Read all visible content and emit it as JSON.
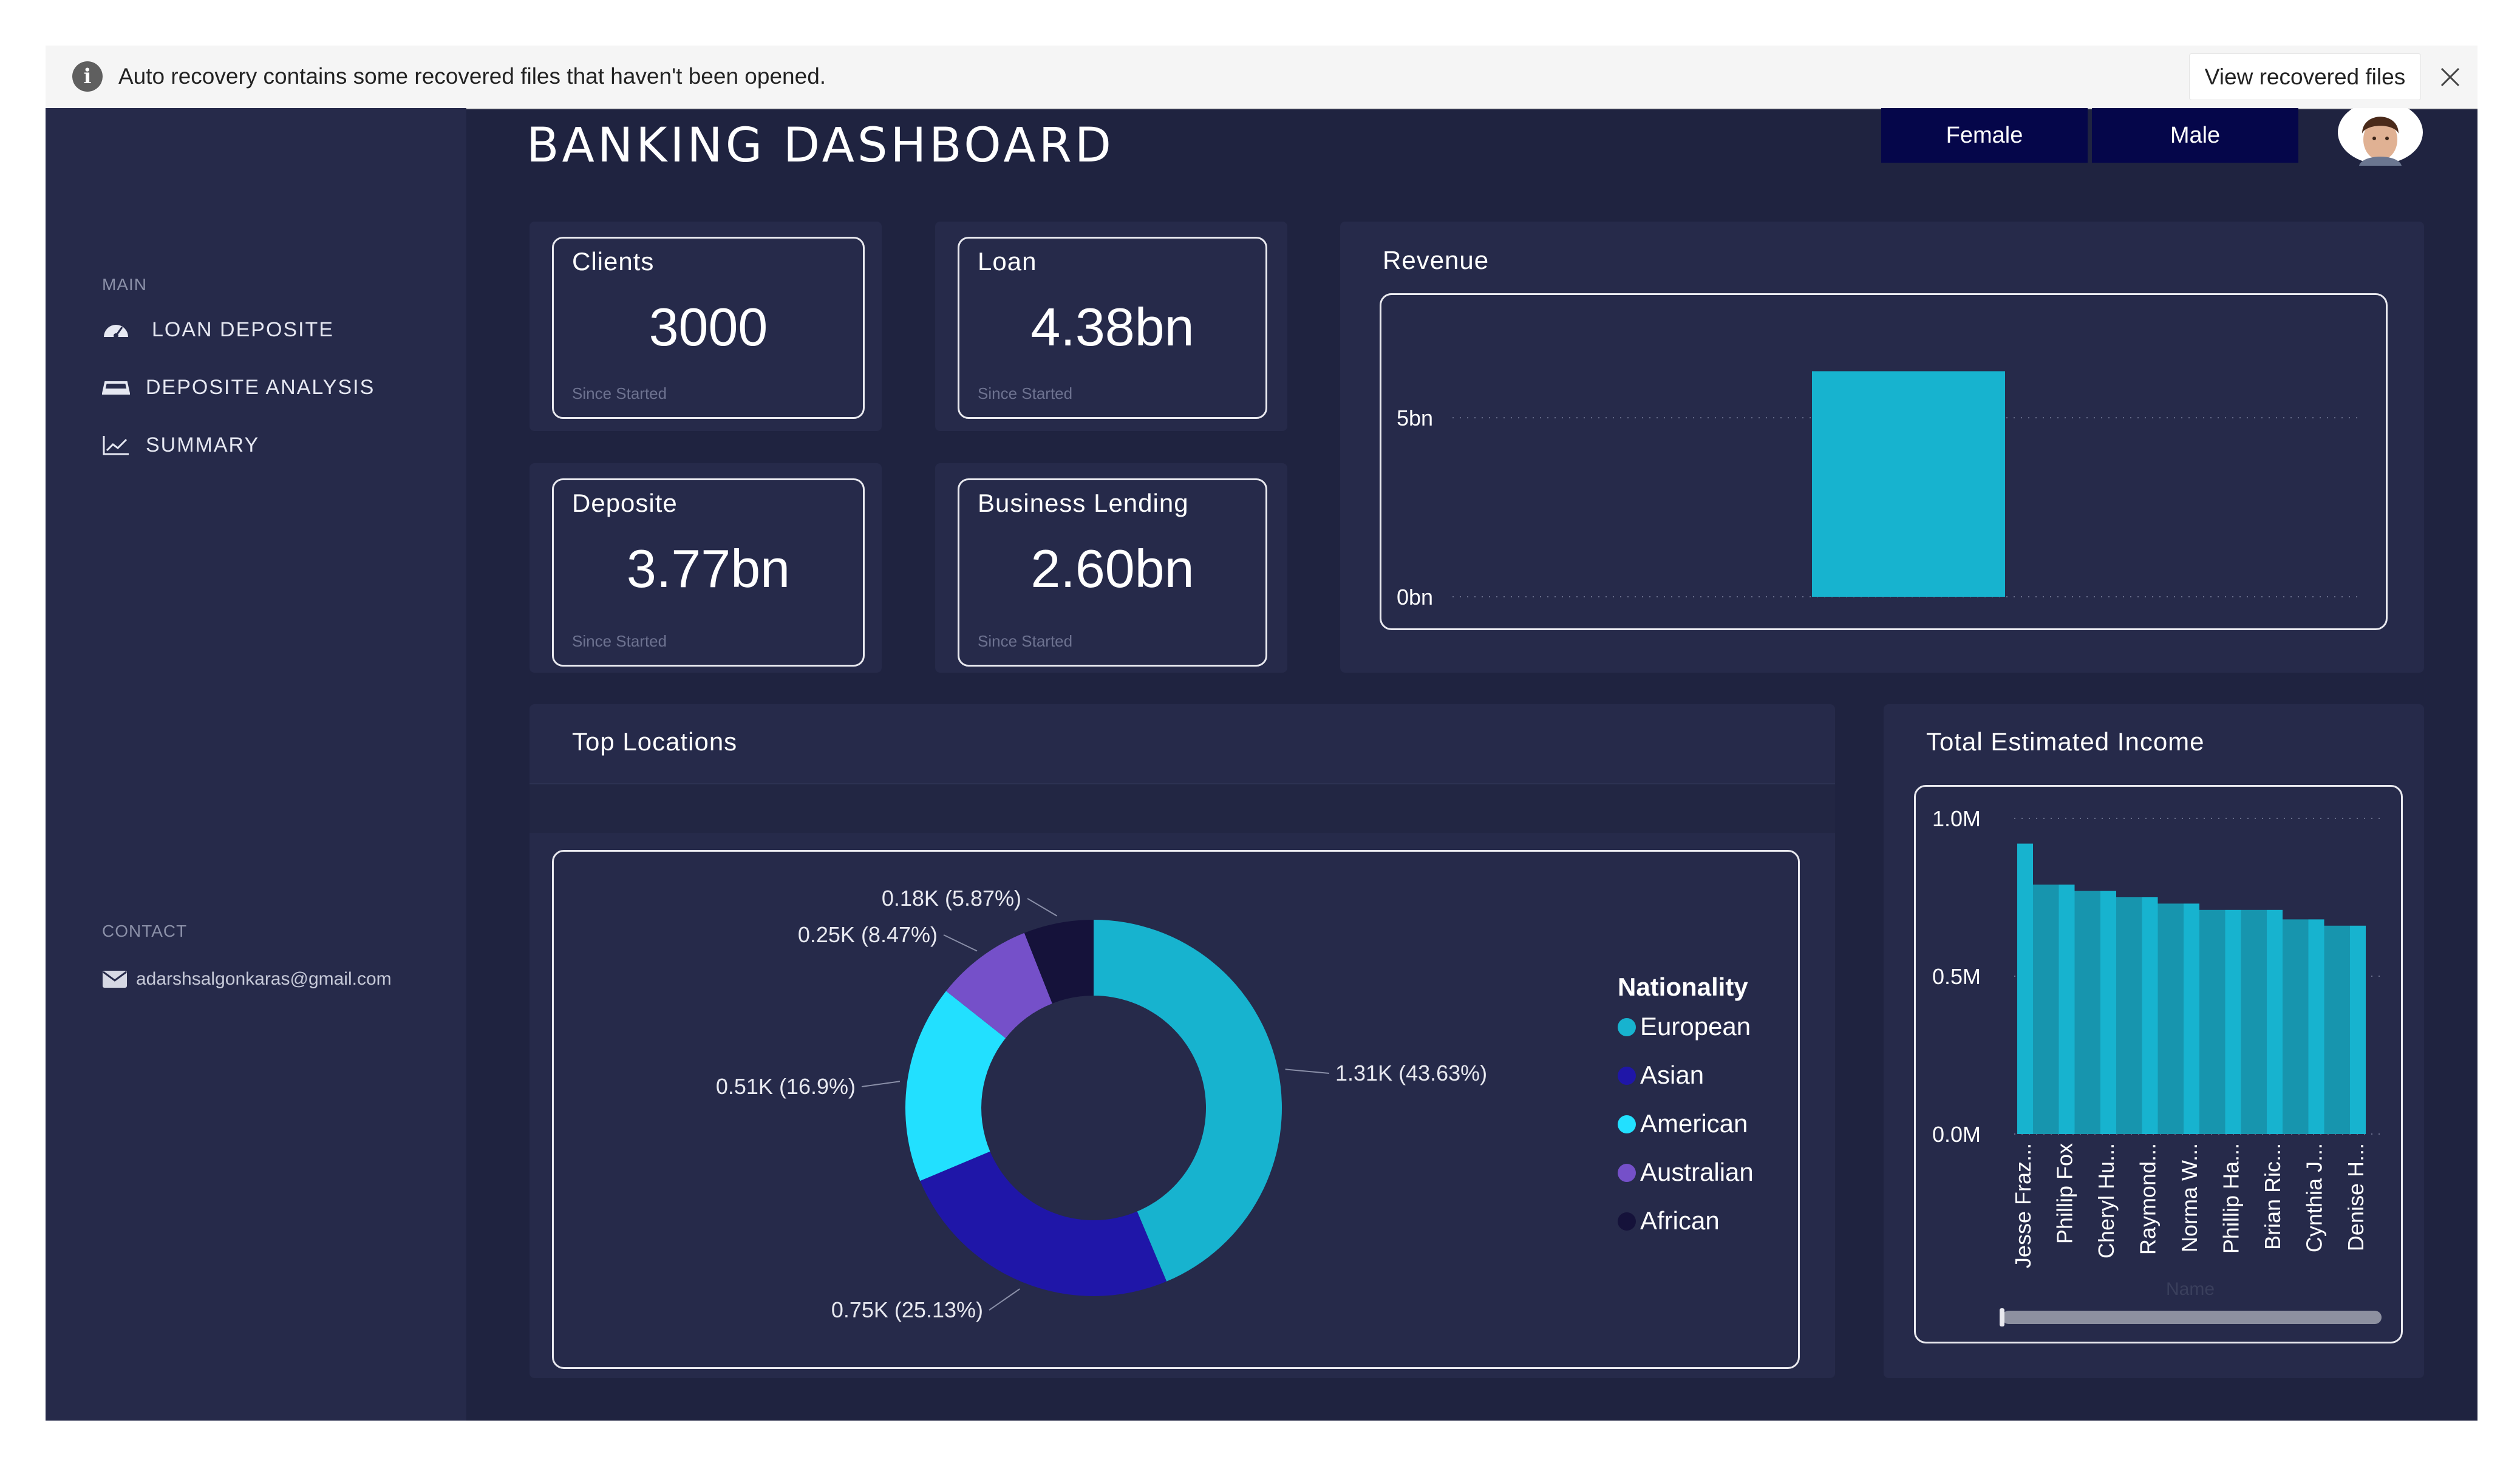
{
  "notification": {
    "message": "Auto recovery contains some recovered files that haven't been opened.",
    "view_button": "View recovered files"
  },
  "sidebar": {
    "main_heading": "MAIN",
    "items": [
      {
        "label": "LOAN DEPOSITE",
        "icon": "dashboard-gauge-icon"
      },
      {
        "label": "DEPOSITE ANALYSIS",
        "icon": "inbox-tray-icon"
      },
      {
        "label": "SUMMARY",
        "icon": "line-chart-icon"
      }
    ],
    "contact_heading": "CONTACT",
    "contact_email": "adarshsalgonkaras@gmail.com"
  },
  "header": {
    "title": "BANKING DASHBOARD",
    "filters": [
      "Female",
      "Male"
    ]
  },
  "kpis": [
    {
      "label": "Clients",
      "value": "3000",
      "sub": "Since Started"
    },
    {
      "label": "Loan",
      "value": "4.38bn",
      "sub": "Since Started"
    },
    {
      "label": "Deposite",
      "value": "3.77bn",
      "sub": "Since Started"
    },
    {
      "label": "Business Lending",
      "value": "2.60bn",
      "sub": "Since Started"
    }
  ],
  "colors": {
    "background": "#1f2340",
    "panel": "#262a4a",
    "bar": "#17b3cf",
    "european": "#17b3cf",
    "asian": "#1f16a8",
    "american": "#22e0ff",
    "australian": "#7550c9",
    "african": "#15123a",
    "filter_button": "#05064a"
  },
  "chart_data": [
    {
      "type": "bar",
      "title": "Revenue",
      "categories": [
        ""
      ],
      "values": [
        6.3
      ],
      "ytick_labels": [
        "0bn",
        "5bn"
      ],
      "ylim": [
        0,
        7.8
      ],
      "grid": true,
      "xlabel": "",
      "ylabel": ""
    },
    {
      "type": "pie",
      "title": "Top Locations",
      "legend_title": "Nationality",
      "legend_position": "right",
      "labels": [
        "European",
        "Asian",
        "American",
        "Australian",
        "African"
      ],
      "values": [
        1.31,
        0.75,
        0.51,
        0.25,
        0.18
      ],
      "data_labels": [
        "1.31K (43.63%)",
        "0.75K (25.13%)",
        "0.51K (16.9%)",
        "0.25K (8.47%)",
        "0.18K (5.87%)"
      ]
    },
    {
      "type": "bar",
      "title": "Total Estimated Income",
      "categories": [
        "Jesse Fraz...",
        "Phillip Fox",
        "Cheryl Hu...",
        "Raymond...",
        "Norma W...",
        "Phillip Ha...",
        "Brian Ric...",
        "Cynthia J...",
        "Denise H..."
      ],
      "values": [
        0.92,
        0.79,
        0.77,
        0.75,
        0.73,
        0.71,
        0.71,
        0.68,
        0.66
      ],
      "ytick_labels": [
        "0.0M",
        "0.5M",
        "1.0M"
      ],
      "ylim": [
        0,
        1.0
      ],
      "xlabel": "Name",
      "grid": true
    }
  ]
}
